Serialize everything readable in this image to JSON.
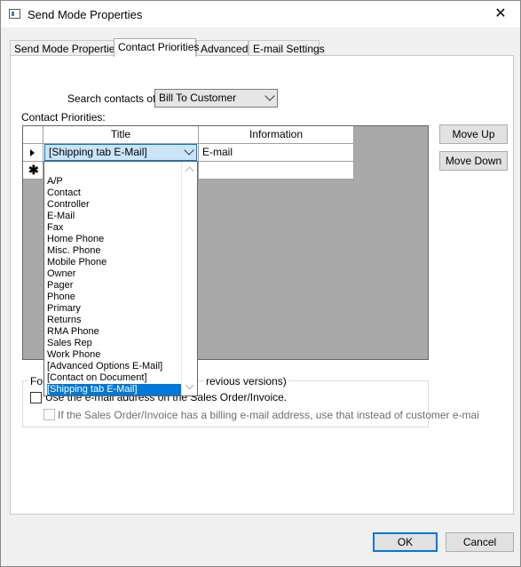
{
  "window": {
    "title": "Send Mode Properties",
    "close_glyph": "✕"
  },
  "tabs": [
    {
      "label": "Send Mode Properties"
    },
    {
      "label": "Contact Priorities"
    },
    {
      "label": "Advanced"
    },
    {
      "label": "E-mail Settings"
    }
  ],
  "search": {
    "label": "Search contacts of:",
    "value": "Bill To Customer"
  },
  "contact_priorities_label": "Contact Priorities:",
  "grid": {
    "columns": [
      "Title",
      "Information"
    ],
    "rows": [
      {
        "title": "[Shipping tab E-Mail]",
        "information": "E-mail"
      }
    ],
    "new_row_glyph": "✱"
  },
  "dropdown": {
    "items": [
      "A/P",
      "Contact",
      "Controller",
      "E-Mail",
      "Fax",
      "Home Phone",
      "Misc. Phone",
      "Mobile Phone",
      "Owner",
      "Pager",
      "Phone",
      "Primary",
      "Returns",
      "RMA Phone",
      "Sales Rep",
      "Work Phone",
      "[Advanced Options E-Mail]",
      "[Contact on Document]",
      "[Shipping tab E-Mail]"
    ],
    "selected_index": 18
  },
  "buttons": {
    "move_up": "Move Up",
    "move_down": "Move Down",
    "ok": "OK",
    "cancel": "Cancel"
  },
  "group": {
    "caption_left": "For",
    "caption_right": "revious versions)",
    "use_email_label": "Use the e-mail address on the Sales Order/Invoice.",
    "billing_label": "If the Sales Order/Invoice has a billing e-mail address, use that instead of customer e-mai"
  }
}
